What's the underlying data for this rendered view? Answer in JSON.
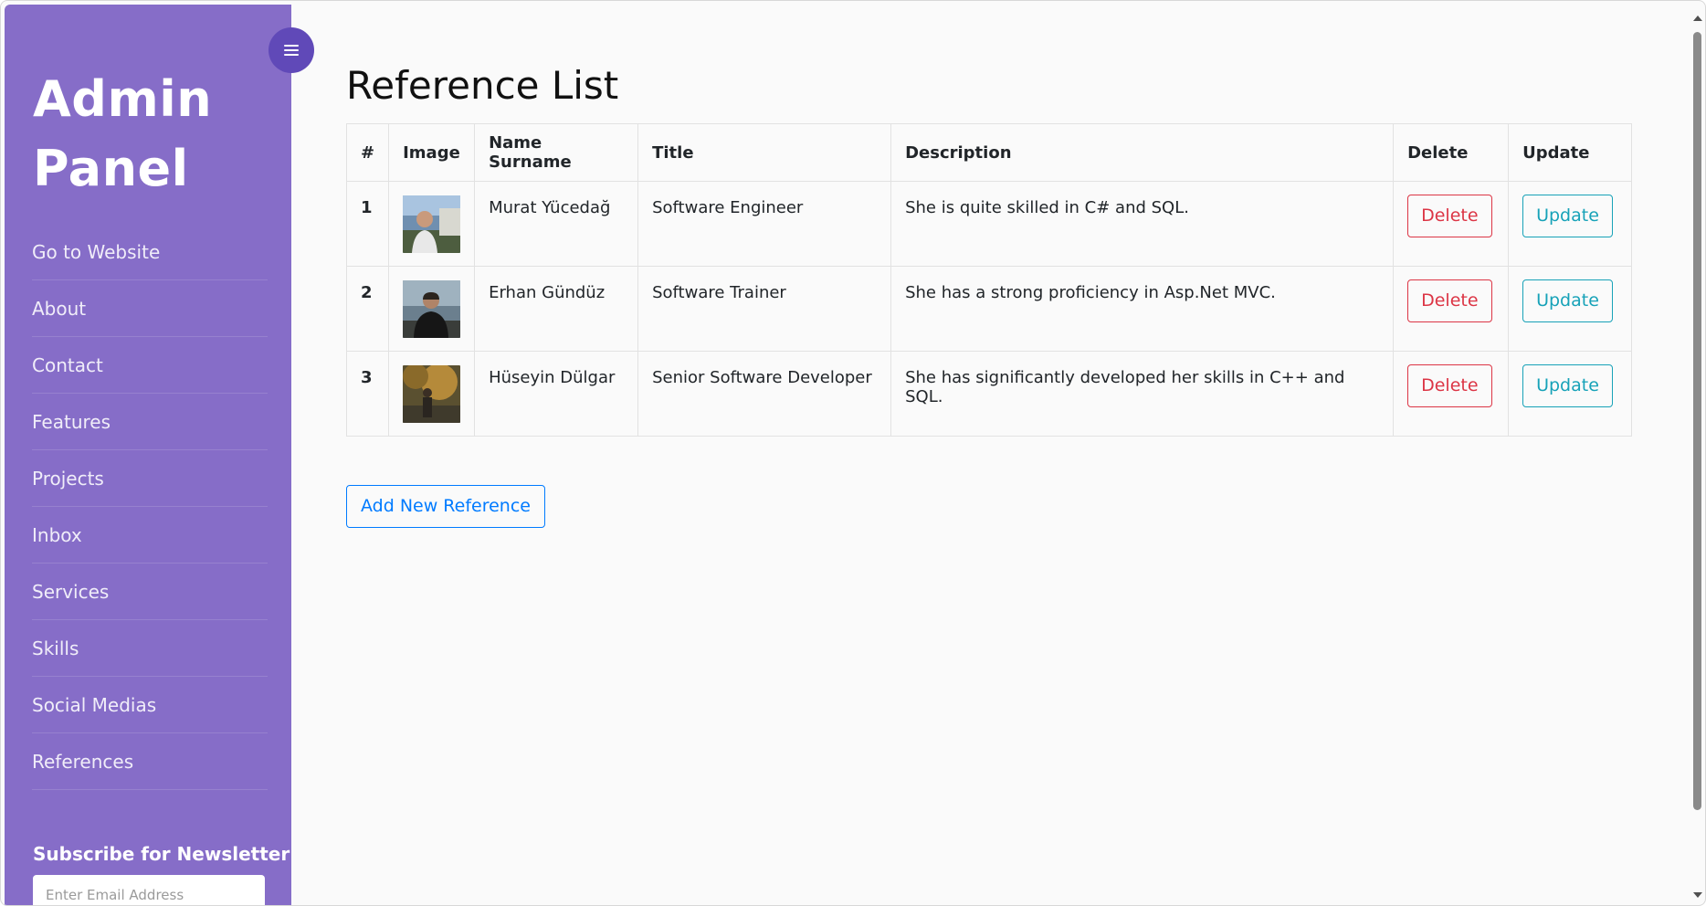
{
  "sidebar": {
    "brand": "Admin Panel",
    "menu": [
      {
        "label": "Go to Website"
      },
      {
        "label": "About"
      },
      {
        "label": "Contact"
      },
      {
        "label": "Features"
      },
      {
        "label": "Projects"
      },
      {
        "label": "Inbox"
      },
      {
        "label": "Services"
      },
      {
        "label": "Skills"
      },
      {
        "label": "Social Medias"
      },
      {
        "label": "References"
      }
    ],
    "newsletter_title": "Subscribe for Newsletter",
    "email_placeholder": "Enter Email Address"
  },
  "main": {
    "title": "Reference List",
    "table": {
      "headers": [
        "#",
        "Image",
        "Name Surname",
        "Title",
        "Description",
        "Delete",
        "Update"
      ],
      "rows": [
        {
          "num": "1",
          "name": "Murat Yücedağ",
          "title": "Software Engineer",
          "description": "She is quite skilled in C# and SQL.",
          "delete_label": "Delete",
          "update_label": "Update"
        },
        {
          "num": "2",
          "name": "Erhan Gündüz",
          "title": "Software Trainer",
          "description": "She has a strong proficiency in Asp.Net MVC.",
          "delete_label": "Delete",
          "update_label": "Update"
        },
        {
          "num": "3",
          "name": "Hüseyin Dülgar",
          "title": "Senior Software Developer",
          "description": "She has significantly developed her skills in C++ and SQL.",
          "delete_label": "Delete",
          "update_label": "Update"
        }
      ]
    },
    "add_button": "Add New Reference"
  },
  "icons": {
    "toggle": "hamburger-menu-icon"
  },
  "colors": {
    "sidebar": "#866dc8",
    "toggle": "#6049b8",
    "delete": "#dc3545",
    "update": "#17a2b8",
    "add": "#007bff"
  }
}
